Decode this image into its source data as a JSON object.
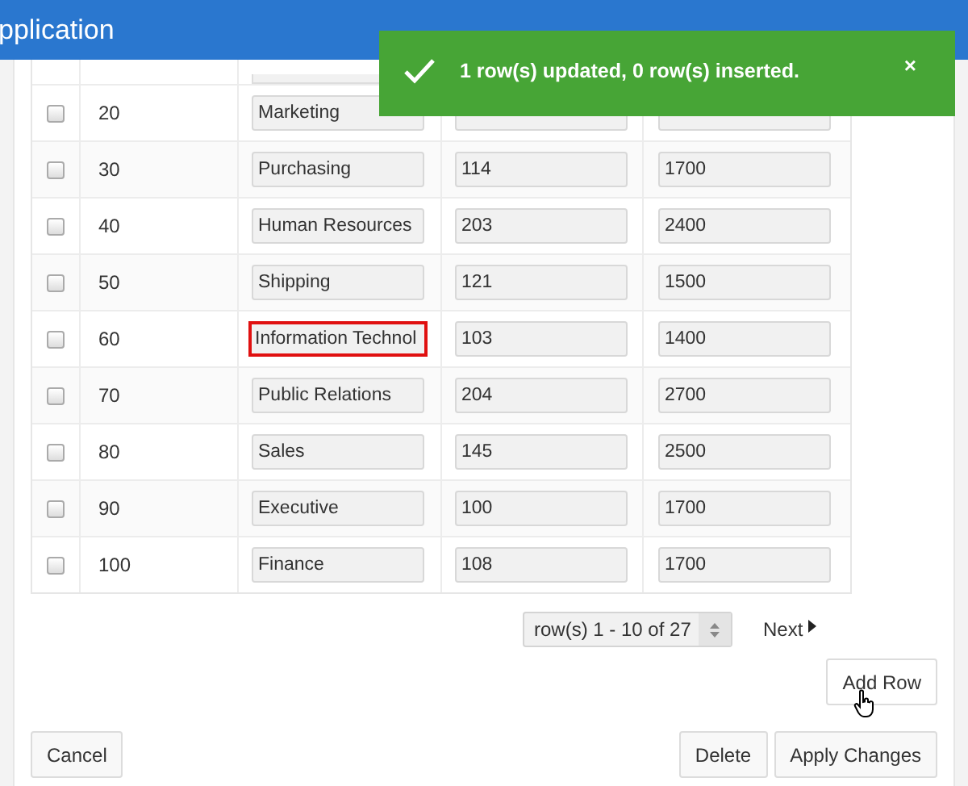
{
  "header": {
    "title": "pplication"
  },
  "toast": {
    "message": "1 row(s) updated, 0 row(s) inserted.",
    "close": "×"
  },
  "rows": [
    {
      "checked": false,
      "id": "20",
      "name": "Marketing",
      "highlighted": false
    },
    {
      "checked": false,
      "id": "30",
      "name": "Purchasing",
      "manager": "114",
      "location": "1700",
      "highlighted": false
    },
    {
      "checked": false,
      "id": "40",
      "name": "Human Resources",
      "manager": "203",
      "location": "2400",
      "highlighted": false
    },
    {
      "checked": false,
      "id": "50",
      "name": "Shipping",
      "manager": "121",
      "location": "1500",
      "highlighted": false
    },
    {
      "checked": false,
      "id": "60",
      "name": "Information Technol",
      "manager": "103",
      "location": "1400",
      "highlighted": true
    },
    {
      "checked": false,
      "id": "70",
      "name": "Public Relations",
      "manager": "204",
      "location": "2700",
      "highlighted": false
    },
    {
      "checked": false,
      "id": "80",
      "name": "Sales",
      "manager": "145",
      "location": "2500",
      "highlighted": false
    },
    {
      "checked": false,
      "id": "90",
      "name": "Executive",
      "manager": "100",
      "location": "1700",
      "highlighted": false
    },
    {
      "checked": false,
      "id": "100",
      "name": "Finance",
      "manager": "108",
      "location": "1700",
      "highlighted": false
    }
  ],
  "pagination": {
    "range": "row(s) 1 - 10 of 27",
    "next": "Next"
  },
  "buttons": {
    "add_row": "Add Row",
    "cancel": "Cancel",
    "delete": "Delete",
    "apply": "Apply Changes"
  }
}
